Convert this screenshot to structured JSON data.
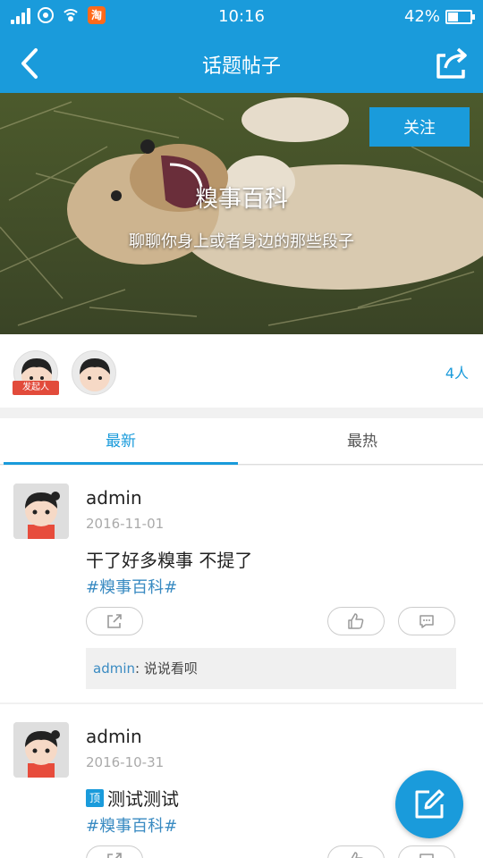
{
  "status_bar": {
    "time": "10:16",
    "battery": "42%",
    "app_badge": "淘"
  },
  "nav": {
    "title": "话题帖子"
  },
  "hero": {
    "follow_label": "关注",
    "title": "糗事百科",
    "subtitle": "聊聊你身上或者身边的那些段子"
  },
  "members": {
    "initiator_badge": "发起人",
    "count_label": "4人"
  },
  "tabs": [
    {
      "label": "最新"
    },
    {
      "label": "最热"
    }
  ],
  "posts": [
    {
      "author": "admin",
      "date": "2016-11-01",
      "content": "干了好多糗事 不提了",
      "tag": "#糗事百科#",
      "comment": {
        "user": "admin",
        "separator": ": ",
        "text": "说说看呗"
      }
    },
    {
      "author": "admin",
      "date": "2016-10-31",
      "top_badge": "顶",
      "content": "测试测试",
      "tag": "#糗事百科#"
    }
  ],
  "colors": {
    "brand": "#1a9bdb",
    "tag": "#3a8bc2",
    "badge_red": "#e24b3b"
  }
}
